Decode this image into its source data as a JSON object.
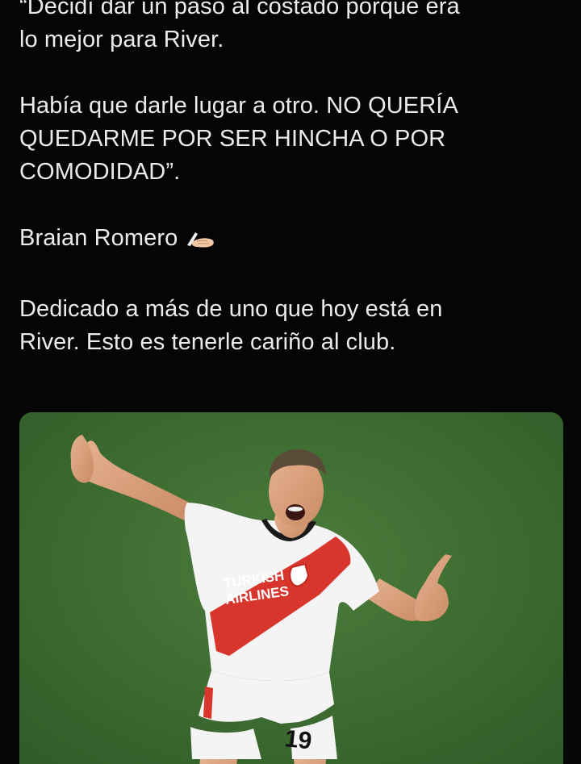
{
  "tweet": {
    "lines": [
      "“Decidí dar un paso al costado porque era",
      "lo mejor para River.",
      "Había que darle lugar a otro. NO QUERÍA",
      "QUEDARME POR SER HINCHA O POR",
      "COMODIDAD”.",
      "Braian Romero",
      "Dedicado a más de uno que hoy está en",
      "River. Esto es tenerle cariño al club."
    ],
    "emoji": "writing-hand-icon"
  },
  "media": {
    "jersey_sponsor_line1": "TURKISH",
    "jersey_sponsor_line2": "AIRLINES",
    "shirt_number": "19"
  },
  "colors": {
    "background": "#050505",
    "text": "#e9ebed",
    "pitch": "#3f6f33",
    "jersey_red": "#d8362c"
  }
}
